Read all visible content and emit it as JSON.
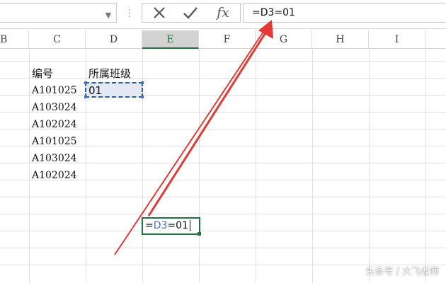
{
  "formula_bar": {
    "name_box_value": "",
    "formula": "=D3=01",
    "cancel_icon": "cross-icon",
    "enter_icon": "check-icon",
    "fx_label": "fx"
  },
  "columns": [
    "B",
    "C",
    "D",
    "E",
    "F",
    "G",
    "H",
    "I"
  ],
  "selected_column": "E",
  "cells": {
    "c_header": "编号",
    "d_header": "所属班级",
    "d_value": "01",
    "c_values": [
      "A101025",
      "A103024",
      "A102024",
      "A101025",
      "A103024",
      "A102024"
    ],
    "edit_eq": "=",
    "edit_ref": "D3",
    "edit_rest": "=01"
  },
  "annotation": {
    "color": "#e53935",
    "description_icon": "red-arrow-icon"
  },
  "watermark": "头条号 / 大飞老师",
  "colors": {
    "accent": "#217346",
    "reference_blue": "#4472c4"
  }
}
